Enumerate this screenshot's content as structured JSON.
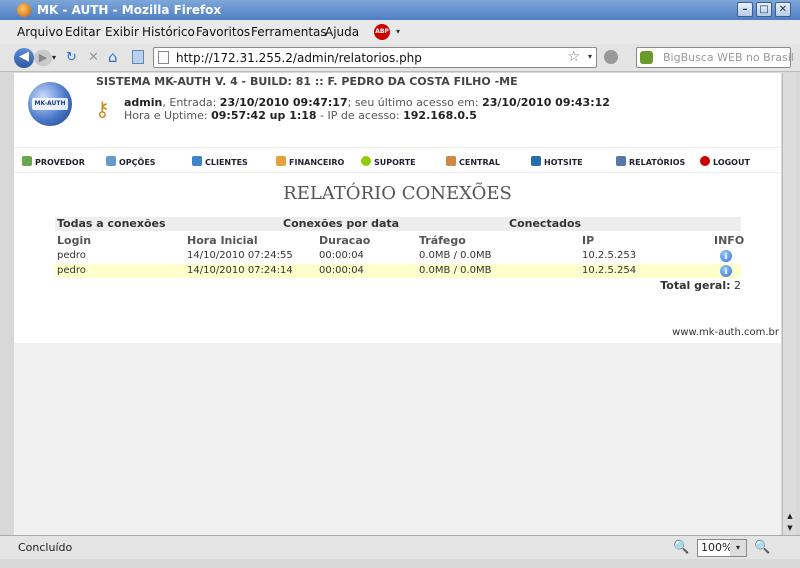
{
  "window": {
    "title": "MK - AUTH - Mozilla Firefox",
    "btn_min": "–",
    "btn_max": "□",
    "btn_close": "✕"
  },
  "menu": [
    "Arquivo",
    "Editar",
    "Exibir",
    "Histórico",
    "Favoritos",
    "Ferramentas",
    "Ajuda"
  ],
  "addon": {
    "abp": "ABP",
    "arrow": "▾"
  },
  "nav": {
    "back": "◀",
    "forward": "▶",
    "dropdown": "▾",
    "reload": "↻",
    "stop": "✕",
    "home": "⌂",
    "url": "http://172.31.255.2/admin/relatorios.php",
    "bookmark": "☆",
    "url_drop": "▾",
    "search_placeholder": "BigBusca WEB no Brasil"
  },
  "header": {
    "logo_text": "MK-AUTH",
    "system": "SISTEMA MK-AUTH V. 4 - BUILD: 81 :: F. PEDRO DA COSTA FILHO -ME",
    "user": "admin",
    "entrada_label": ", Entrada: ",
    "entrada": "23/10/2010 09:47:17",
    "ultimo_label": "; seu último acesso em: ",
    "ultimo": "23/10/2010 09:43:12",
    "uptime_label": "Hora e Uptime: ",
    "uptime": "09:57:42 up 1:18",
    "ip_label": " - IP de acesso: ",
    "ip": "192.168.0.5"
  },
  "mainmenu": [
    {
      "label": "PROVEDOR",
      "color": "#6aa84f"
    },
    {
      "label": "OPÇÕES",
      "color": "#6699cc"
    },
    {
      "label": "CLIENTES",
      "color": "#3d85c6"
    },
    {
      "label": "FINANCEIRO",
      "color": "#e6a23c"
    },
    {
      "label": "SUPORTE",
      "color": "#8fce00"
    },
    {
      "label": "CENTRAL",
      "color": "#cc8844"
    },
    {
      "label": "HOTSITE",
      "color": "#2b6cb0"
    },
    {
      "label": "RELATÓRIOS",
      "color": "#5577aa"
    },
    {
      "label": "LOGOUT",
      "color": "#cc0000"
    }
  ],
  "page": {
    "title": "RELATÓRIO CONEXÕES",
    "tabs": [
      "Todas a conexões",
      "Conexões por data",
      "Conectados"
    ],
    "columns": [
      "Login",
      "Hora Inicial",
      "Duracao",
      "Tráfego",
      "IP",
      "INFO"
    ],
    "rows": [
      {
        "login": "pedro",
        "hora": "14/10/2010 07:24:55",
        "duracao": "00:00:04",
        "trafego": "0.0MB / 0.0MB",
        "ip": "10.2.5.253",
        "info": "i"
      },
      {
        "login": "pedro",
        "hora": "14/10/2010 07:24:14",
        "duracao": "00:00:04",
        "trafego": "0.0MB / 0.0MB",
        "ip": "10.2.5.254",
        "info": "i"
      }
    ],
    "total_label": "Total geral:",
    "total_value": "2",
    "footer": "www.mk-auth.com.br"
  },
  "scrollbar": {
    "up": "▲",
    "down": "▼"
  },
  "status": {
    "text": "Concluído",
    "zoom_out": "🔍",
    "zoom": "100%",
    "zoom_drop": "▾",
    "zoom_in": "🔍"
  }
}
